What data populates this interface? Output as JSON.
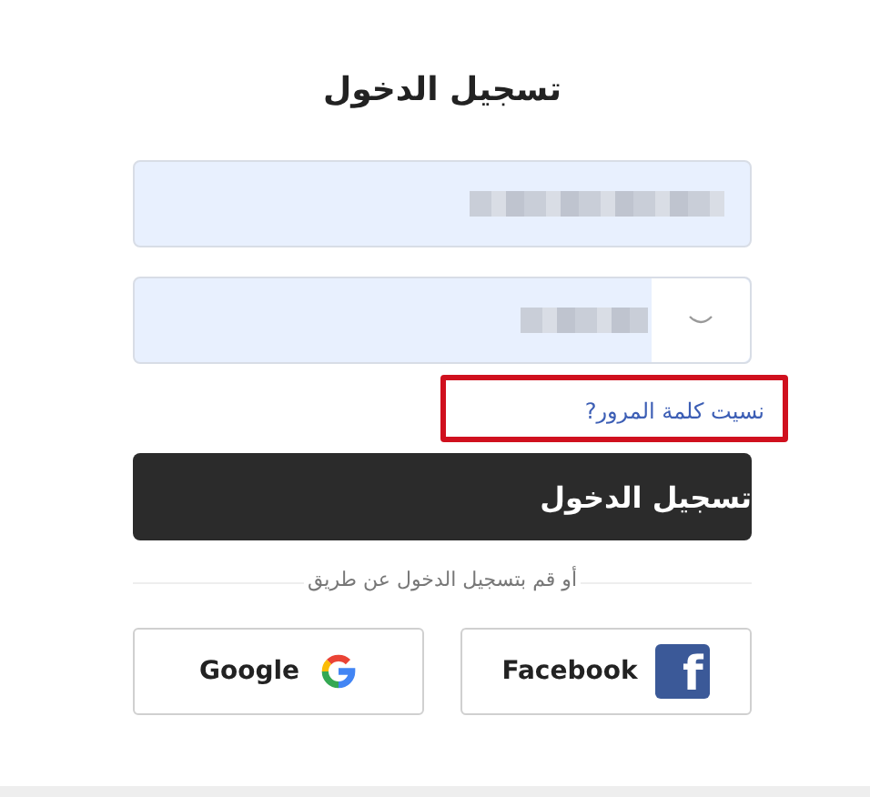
{
  "title": "تسجيل الدخول",
  "fields": [
    {
      "kind": "email",
      "redacted": true,
      "autofilled": true
    },
    {
      "kind": "password",
      "redacted": true,
      "autofilled": true
    }
  ],
  "forgot_link": {
    "label": "نسيت كلمة المرور?",
    "highlighted": true
  },
  "submit": {
    "label": "تسجيل الدخول"
  },
  "divider": {
    "label": "أو قم بتسجيل الدخول عن طريق"
  },
  "social": [
    {
      "kind": "facebook",
      "label": "Facebook",
      "glyph": "f"
    },
    {
      "kind": "google",
      "label": "Google"
    }
  ]
}
